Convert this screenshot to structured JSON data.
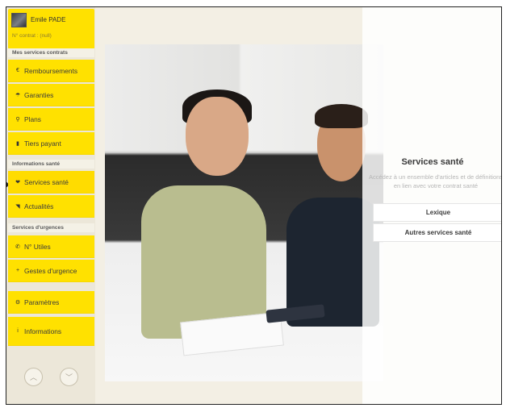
{
  "user": {
    "name": "Emile PADE",
    "contract": "N° contrat : (null)"
  },
  "sidebar": {
    "sections": [
      {
        "header": "Mes services contrats",
        "items": [
          {
            "icon": "euro-icon",
            "glyph": "€",
            "label": "Remboursements"
          },
          {
            "icon": "umbrella-icon",
            "glyph": "☂",
            "label": "Garanties"
          },
          {
            "icon": "map-pin-icon",
            "glyph": "⚲",
            "label": "Plans"
          },
          {
            "icon": "card-icon",
            "glyph": "▮",
            "label": "Tiers payant"
          }
        ]
      },
      {
        "header": "Informations santé",
        "items": [
          {
            "icon": "heart-icon",
            "glyph": "❤",
            "label": "Services santé",
            "active": true
          },
          {
            "icon": "rss-icon",
            "glyph": "◥",
            "label": "Actualités"
          }
        ]
      },
      {
        "header": "Services d'urgences",
        "items": [
          {
            "icon": "phone-icon",
            "glyph": "✆",
            "label": "N° Utiles"
          },
          {
            "icon": "plus-icon",
            "glyph": "+",
            "label": "Gestes d'urgence"
          }
        ]
      },
      {
        "header": "",
        "items": [
          {
            "icon": "settings-icon",
            "glyph": "⚙",
            "label": "Paramètres"
          },
          {
            "icon": "info-icon",
            "glyph": "i",
            "label": "Informations"
          }
        ]
      }
    ],
    "nav": {
      "up": "up-arrow-icon",
      "down": "down-arrow-icon"
    }
  },
  "panel": {
    "title": "Services santé",
    "description": "Accédez à un ensemble d'articles et de définitions en lien avec votre contrat santé",
    "buttons": [
      "Lexique",
      "Autres services santé"
    ]
  },
  "colors": {
    "accent": "#ffe100",
    "background": "#f3efe4",
    "panel": "#ffffff"
  }
}
